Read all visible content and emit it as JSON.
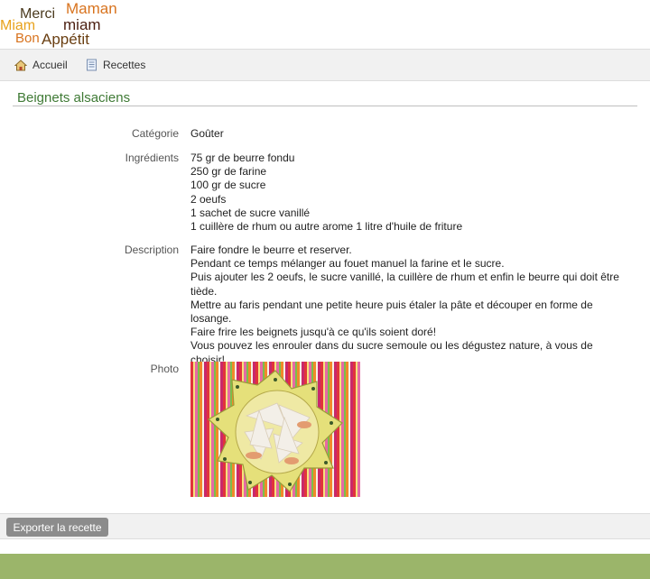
{
  "logo": {
    "words": [
      "Merci",
      "Maman",
      "Miam",
      "miam",
      "Bon",
      "Appétit"
    ]
  },
  "nav": {
    "items": [
      {
        "label": "Accueil",
        "icon": "home-icon"
      },
      {
        "label": "Recettes",
        "icon": "recipes-icon"
      }
    ]
  },
  "recipe": {
    "title": "Beignets alsaciens",
    "category_label": "Catégorie",
    "category": "Goûter",
    "ingredients_label": "Ingrédients",
    "ingredients": [
      "75 gr de beurre fondu",
      "250 gr de farine",
      "100 gr de sucre",
      "2 oeufs",
      "1 sachet de sucre vanillé",
      "1 cuillère de rhum ou autre arome 1 litre d'huile de friture"
    ],
    "description_label": "Description",
    "description": [
      "Faire fondre le beurre et reserver.",
      "Pendant ce temps mélanger au fouet manuel la farine et le sucre.",
      "Puis ajouter les 2 oeufs, le sucre vanillé, la cuillère de rhum et enfin le beurre qui doit être tiède.",
      "Mettre au faris pendant une petite heure puis étaler la pâte et découper en forme de losange.",
      "Faire frire les beignets jusqu'à ce qu'ils soient doré!",
      "Vous pouvez les enrouler dans du sucre semoule ou les dégustez nature, à vous de choisir!"
    ],
    "photo_label": "Photo"
  },
  "actions": {
    "export_label": "Exporter la recette"
  },
  "colors": {
    "title": "#3f7a35",
    "footer": "#9bb56a",
    "button": "#8c8c8c"
  }
}
